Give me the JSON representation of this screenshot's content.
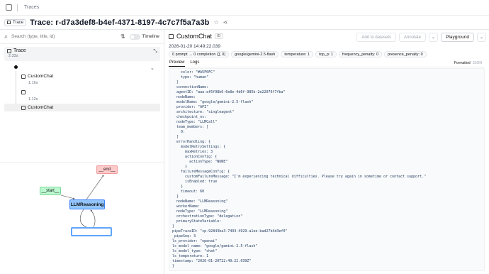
{
  "breadcrumb": {
    "label": "Traces"
  },
  "title": {
    "tag": "Trace",
    "text": "Trace: r-d7a3def8-b4ef-4371-8197-4c7c7f5a7a3b"
  },
  "left": {
    "search_placeholder": "Search (type, title, id)",
    "timeline_label": "Timeline",
    "root": {
      "name": "Trace",
      "duration": "2.33s"
    },
    "tree": [
      {
        "name": "CustomChat",
        "duration": "1.16s"
      },
      {
        "name": "",
        "duration": "1.12s"
      },
      {
        "name": "CustomChat",
        "duration": ""
      }
    ],
    "graph": {
      "end_label": "__end__",
      "start_label": "__start__",
      "llm_label": "LLMReasoning",
      "blank_label": ""
    }
  },
  "right": {
    "obs_name": "CustomChat",
    "id_label": "ID",
    "actions": {
      "add_dataset": "Add to datasets",
      "annotate": "Annotate",
      "playground": "Playground"
    },
    "timestamp": "2026-01-20 14:49:22.039",
    "chips": [
      "0 prompt → 0 completion (∑ 0)",
      "google/gemini-2.5-flash",
      "temperature: 1",
      "top_p: 1",
      "frequency_penalty: 0",
      "presence_penalty: 0"
    ],
    "tabs": [
      "Preview",
      "Logs"
    ],
    "formatted_label": "Formatted",
    "json_label": "JSON",
    "json_lines": [
      "    color: \"#A5F0FC\"",
      "    type: \"human\"",
      "  }",
      "  connectionName:",
      "  agentID: \"aaa-af6f98b6-6e8e-4d6f-985b-2e22076f7fba\"",
      "  nodeName:",
      "  modelName: \"google/gemini-2.5-flash\"",
      "  provider: \"API\"",
      "  architecture: \"singleagent\"",
      "  checkpoint_ns:",
      "  nodeType: \"LLMCall\"",
      "  team_members: [",
      "    0:",
      "  ]",
      "  errorHandling: {",
      "    modelRetrySettings: {",
      "      maxRetries: 3",
      "      actionConfig: {",
      "        actionType: \"NONE\"",
      "      }",
      "    failureMessageConfig: {",
      "      customFailureMessage: \"I'm experiencing technical difficulties. Please try again in sometime or contact support.\"",
      "      isEnabled: true",
      "    }",
      "    timeout: 60",
      "  }",
      "  nodeName: \"LLMReasoning\"",
      "  workerName:",
      "  nodeType: \"LLMReasoning\"",
      "  orchestrationType: \"delegation\"",
      "  primaryStateVariable:",
      "}",
      "pipeTraceID: \"sp-92843ba3-7493-4929-a1ee-bad27b4d3ef0\"",
      "_pipeSeq: 3",
      "ls_provider: \"openai\"",
      "ls_model_name: \"google/gemini-2.5-flash\"",
      "ls_model_type: \"chat\"",
      "ls_temperature: 1",
      "timestamp: \"2026-01-20T22:49:22.039Z\"",
      "}"
    ]
  }
}
